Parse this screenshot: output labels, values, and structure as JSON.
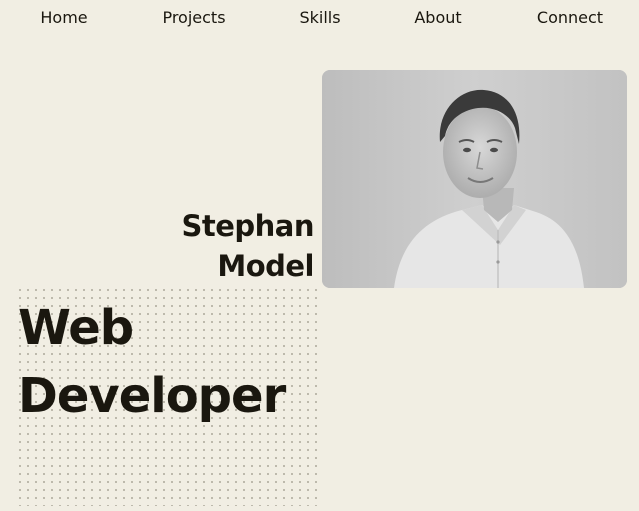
{
  "nav": {
    "items": [
      {
        "label": "Home"
      },
      {
        "label": "Projects"
      },
      {
        "label": "Skills"
      },
      {
        "label": "About"
      },
      {
        "label": "Connect"
      }
    ]
  },
  "hero": {
    "first_name": "Stephan",
    "last_name": "Model",
    "title_line1": "Web",
    "title_line2": "Developer",
    "photo_icon": "portrait-photo"
  },
  "colors": {
    "background": "#f1eee3",
    "text": "#1a170f",
    "dots": "#b9b5a8"
  }
}
